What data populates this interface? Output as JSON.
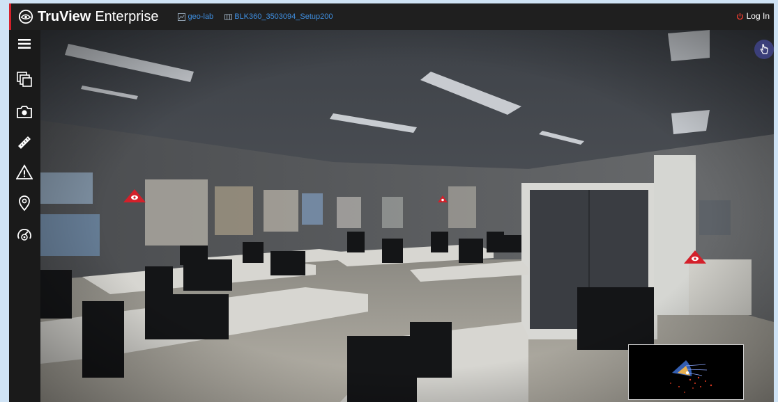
{
  "app": {
    "brand_bold": "TruView",
    "brand_light": "Enterprise"
  },
  "breadcrumb": {
    "site": "geo-lab",
    "setup": "BLK360_3503094_Setup200"
  },
  "header": {
    "login_label": "Log In"
  },
  "colors": {
    "accent": "#d4202a",
    "link": "#3f8fe0",
    "topbar": "#1f1f1f",
    "sidebar": "#1a1a1a",
    "marker": "#d4202a"
  },
  "sidebar": {
    "tools": [
      "menu-icon",
      "layers-icon",
      "camera-icon",
      "measure-icon",
      "warning-icon",
      "location-pin-icon",
      "speedometer-icon"
    ]
  }
}
